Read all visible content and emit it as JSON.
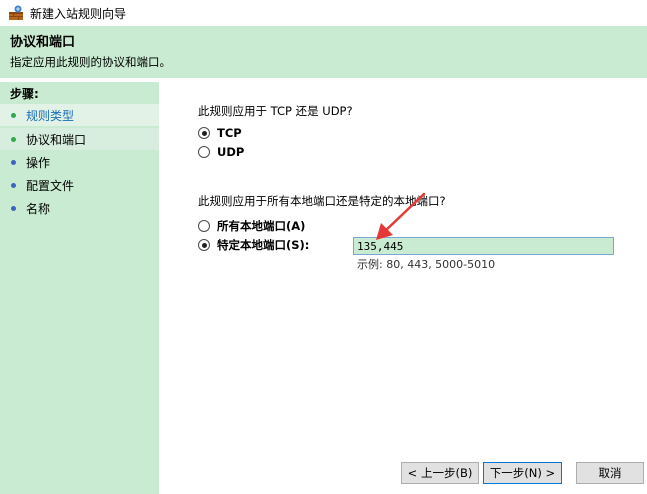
{
  "window": {
    "title": "新建入站规则向导",
    "icon": "firewall-wizard-icon"
  },
  "header": {
    "title": "协议和端口",
    "subtitle": "指定应用此规则的协议和端口。"
  },
  "sidebar": {
    "title": "步骤:",
    "items": [
      {
        "label": "规则类型",
        "color": "#1a6fb5",
        "state": "completed"
      },
      {
        "label": "协议和端口",
        "color": "#000000",
        "state": "current"
      },
      {
        "label": "操作",
        "color": "#000000",
        "state": "pending"
      },
      {
        "label": "配置文件",
        "color": "#000000",
        "state": "pending"
      },
      {
        "label": "名称",
        "color": "#000000",
        "state": "pending"
      }
    ]
  },
  "protocol": {
    "question": "此规则应用于 TCP 还是 UDP?",
    "options": [
      "TCP",
      "UDP"
    ],
    "selected": "TCP"
  },
  "ports": {
    "question": "此规则应用于所有本地端口还是特定的本地端口?",
    "options": [
      "所有本地端口(A)",
      "特定本地端口(S):"
    ],
    "selected": "特定本地端口(S):",
    "value": "135,445",
    "example": "示例: 80, 443, 5000-5010"
  },
  "buttons": {
    "back": "< 上一步(B)",
    "next": "下一步(N) >",
    "cancel": "取消"
  },
  "colors": {
    "accent_green": "#c9ebd1",
    "annotation_arrow": "#e53935",
    "input_border": "#7aa7d6"
  }
}
